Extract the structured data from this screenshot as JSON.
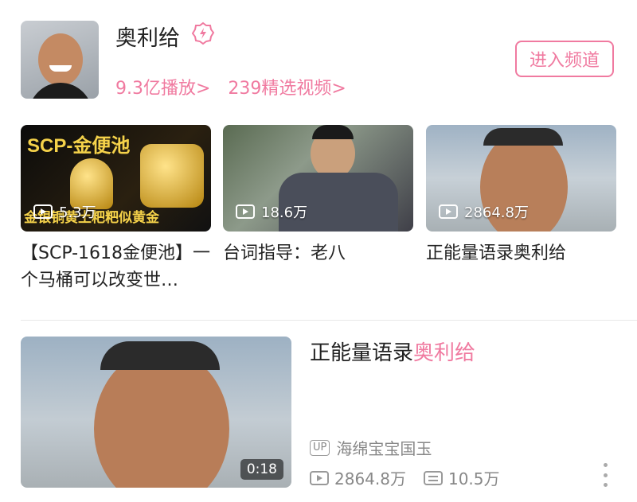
{
  "channel": {
    "name": "奥利给",
    "stats": [
      "9.3亿播放>",
      "239精选视频>"
    ],
    "enter_label": "进入频道"
  },
  "videos": [
    {
      "thumb_text": "SCP-金便池",
      "thumb_caption": "金银铜黄土粑粑似黄金",
      "views": "5.3万",
      "title": "【SCP-1618金便池】一个马桶可以改变世…"
    },
    {
      "views": "18.6万",
      "title": "台词指导：老八"
    },
    {
      "views": "2864.8万",
      "title": "正能量语录奥利给"
    }
  ],
  "featured": {
    "title_prefix": "正能量语录",
    "title_highlight": "奥利给",
    "duration": "0:18",
    "up_badge": "UP",
    "uploader": "海绵宝宝国玉",
    "views": "2864.8万",
    "danmaku": "10.5万"
  },
  "colors": {
    "accent": "#f07aa0"
  },
  "icons": [
    "verified-lightning-icon",
    "play-count-icon",
    "danmaku-icon",
    "more-vertical-icon"
  ]
}
